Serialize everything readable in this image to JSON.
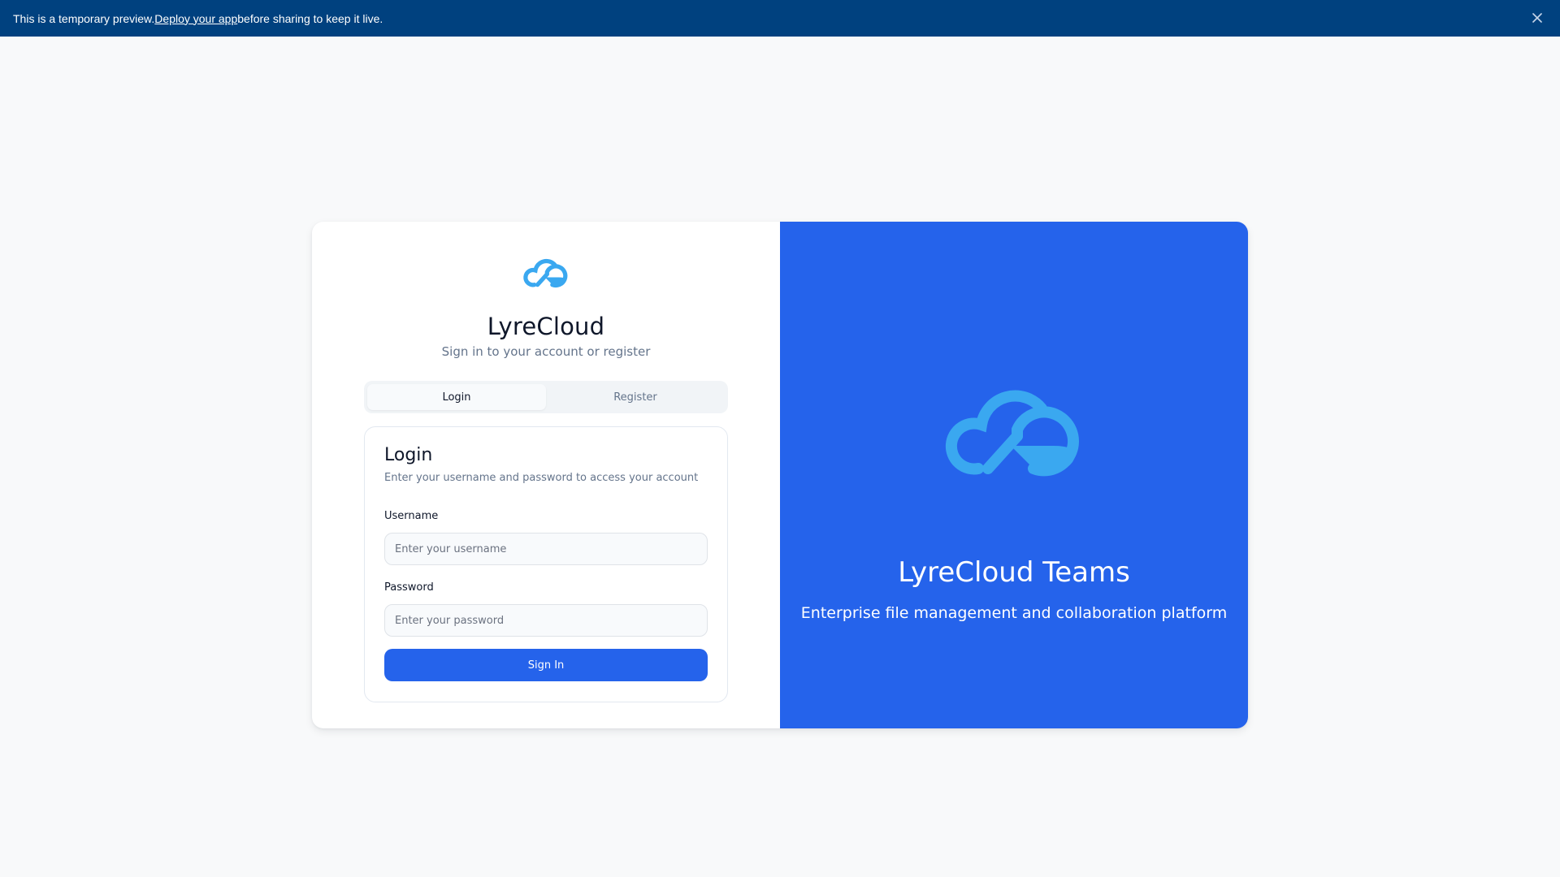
{
  "banner": {
    "text_before": "This is a temporary preview. ",
    "link": "Deploy your app",
    "text_after": " before sharing to keep it live.",
    "close_icon": "close-icon"
  },
  "brand": {
    "name": "LyreCloud",
    "subtitle": "Sign in to your account or register",
    "logo_icon": "cloud-logo-icon",
    "logo_color": "#3aa8f0"
  },
  "tabs": [
    {
      "label": "Login",
      "active": true
    },
    {
      "label": "Register",
      "active": false
    }
  ],
  "login_form": {
    "title": "Login",
    "description": "Enter your username and password to access your account",
    "username_label": "Username",
    "username_placeholder": "Enter your username",
    "password_label": "Password",
    "password_placeholder": "Enter your password",
    "submit_label": "Sign In"
  },
  "promo": {
    "title": "LyreCloud Teams",
    "subtitle": "Enterprise file management and collaboration platform",
    "background": "#2563eb"
  },
  "colors": {
    "banner": "#00417f",
    "accent": "#2563eb"
  }
}
